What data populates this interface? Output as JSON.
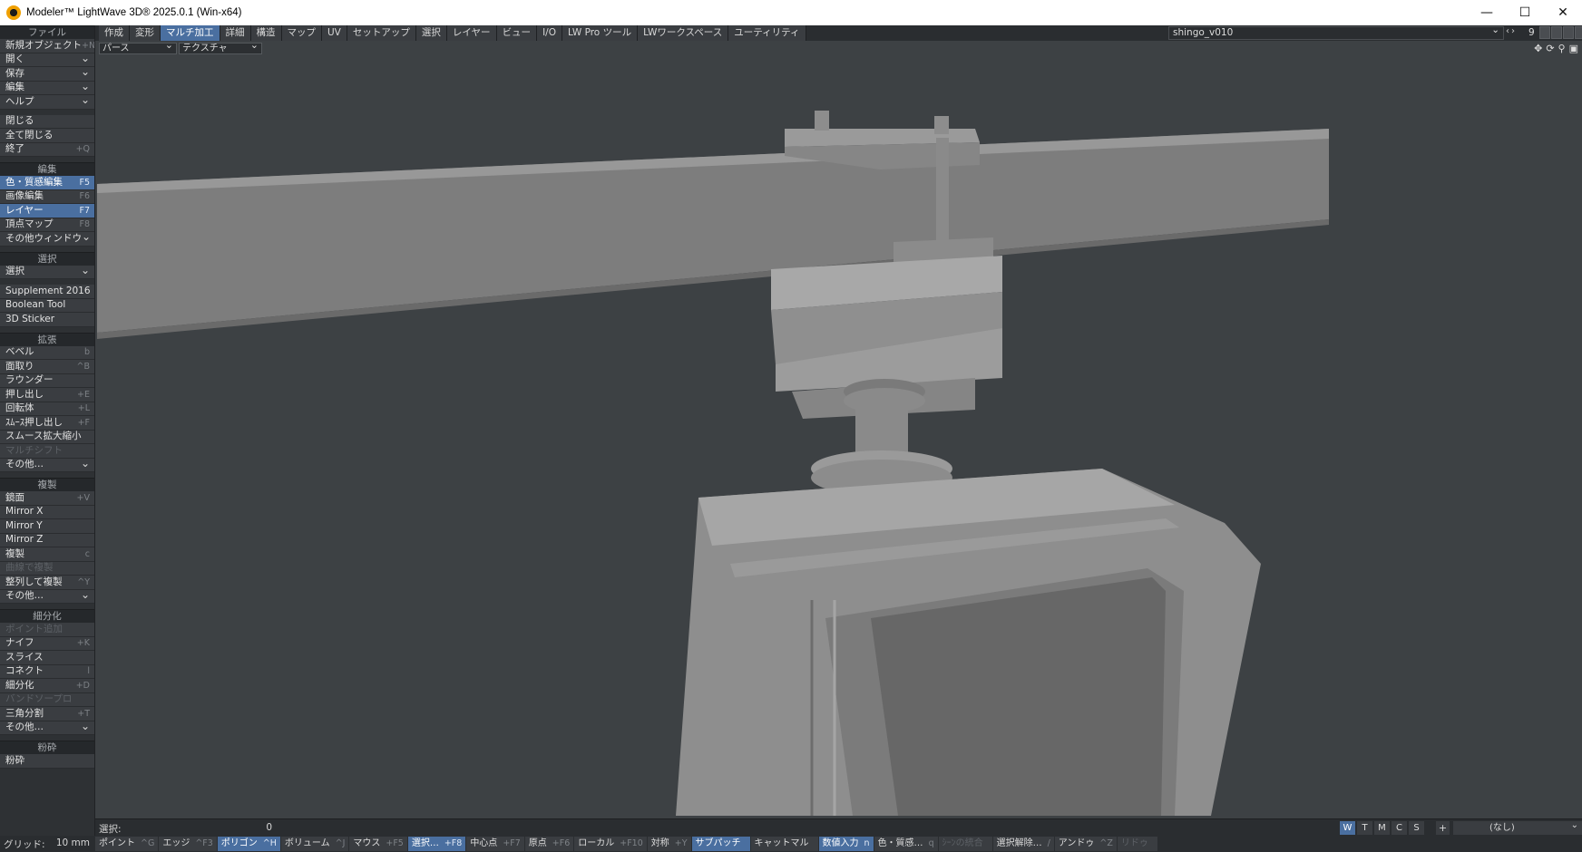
{
  "window": {
    "title": "Modeler™ LightWave 3D® 2025.0.1 (Win-x64)",
    "minimize": "—",
    "maximize": "☐",
    "close": "✕"
  },
  "tabs": [
    "作成",
    "変形",
    "マルチ加工",
    "詳細",
    "構造",
    "マップ",
    "UV",
    "セットアップ",
    "選択",
    "レイヤー",
    "ビュー",
    "I/O",
    "LW Pro ツール",
    "LWワークスペース",
    "ユーティリティ"
  ],
  "active_tab": "マルチ加工",
  "scene": {
    "name": "shingo_v010",
    "layer_number": "9"
  },
  "viewport": {
    "view_mode": "パース",
    "render_mode": "テクスチャ"
  },
  "sidebar": {
    "file_header": "ファイル",
    "file": [
      {
        "label": "新規オブジェクト",
        "sc": "+N"
      },
      {
        "label": "開く",
        "dd": true
      },
      {
        "label": "保存",
        "dd": true
      },
      {
        "label": "編集",
        "dd": true
      },
      {
        "label": "ヘルプ",
        "dd": true
      }
    ],
    "file2": [
      {
        "label": "閉じる",
        "sc": ""
      },
      {
        "label": "全て閉じる",
        "sc": ""
      },
      {
        "label": "終了",
        "sc": "+Q"
      }
    ],
    "edit_header": "編集",
    "edit": [
      {
        "label": "色・質感編集",
        "sc": "F5",
        "active": true
      },
      {
        "label": "画像編集",
        "sc": "F6"
      },
      {
        "label": "レイヤー",
        "sc": "F7",
        "active": true
      },
      {
        "label": "頂点マップ",
        "sc": "F8"
      },
      {
        "label": "その他ウィンドウ",
        "dd": true
      }
    ],
    "select_header": "選択",
    "select": [
      {
        "label": "選択",
        "dd": true
      }
    ],
    "plugins": [
      {
        "label": "Supplement 2016",
        "sc": ""
      },
      {
        "label": "Boolean Tool",
        "sc": ""
      },
      {
        "label": "3D Sticker",
        "sc": ""
      }
    ],
    "extend_header": "拡張",
    "extend": [
      {
        "label": "ベベル",
        "sc": "b"
      },
      {
        "label": "面取り",
        "sc": "^B"
      },
      {
        "label": "ラウンダー",
        "sc": ""
      },
      {
        "label": "押し出し",
        "sc": "+E"
      },
      {
        "label": "回転体",
        "sc": "+L"
      },
      {
        "label": "ｽﾑｰｽ押し出し",
        "sc": "+F"
      },
      {
        "label": "スムース拡大縮小",
        "sc": ""
      },
      {
        "label": "マルチシフト",
        "sc": "",
        "disabled": true
      },
      {
        "label": "その他…",
        "dd": true
      }
    ],
    "duplicate_header": "複製",
    "duplicate": [
      {
        "label": "鏡面",
        "sc": "+V"
      },
      {
        "label": "Mirror X",
        "sc": ""
      },
      {
        "label": "Mirror Y",
        "sc": ""
      },
      {
        "label": "Mirror Z",
        "sc": ""
      },
      {
        "label": "複製",
        "sc": "c"
      },
      {
        "label": "曲線で複製",
        "sc": "",
        "disabled": true
      },
      {
        "label": "整列して複製",
        "sc": "^Y"
      },
      {
        "label": "その他…",
        "dd": true
      }
    ],
    "subdivide_header": "細分化",
    "subdivide": [
      {
        "label": "ポイント追加",
        "sc": "",
        "disabled": true
      },
      {
        "label": "ナイフ",
        "sc": "+K"
      },
      {
        "label": "スライス",
        "sc": ""
      },
      {
        "label": "コネクト",
        "sc": "l"
      },
      {
        "label": "細分化",
        "sc": "+D"
      },
      {
        "label": "バンドソープロ",
        "sc": "",
        "disabled": true
      },
      {
        "label": "三角分割",
        "sc": "+T"
      },
      {
        "label": "その他…",
        "dd": true
      }
    ],
    "shatter_header": "粉砕",
    "shatter": [
      {
        "label": "粉砕",
        "sc": ""
      }
    ]
  },
  "status": {
    "selection_label": "選択:",
    "selection_count": "0",
    "wtmcs": [
      "W",
      "T",
      "M",
      "C",
      "S"
    ],
    "plus": "+",
    "none_select": "(なし)"
  },
  "bottom": {
    "grid_label": "グリッド:",
    "grid_value": "10 mm",
    "buttons": [
      {
        "label": "ポイント",
        "sc": "^G"
      },
      {
        "label": "エッジ",
        "sc": "^F3"
      },
      {
        "label": "ポリゴン",
        "sc": "^H",
        "on": true
      },
      {
        "label": "ボリューム",
        "sc": "^J"
      },
      {
        "label": "マウス",
        "sc": "+F5"
      },
      {
        "label": "選択…",
        "sc": "+F8",
        "on": true
      },
      {
        "label": "中心点",
        "sc": "+F7"
      },
      {
        "label": "原点",
        "sc": "+F6"
      },
      {
        "label": "ローカル",
        "sc": "+F10"
      },
      {
        "label": "対称",
        "sc": "+Y"
      },
      {
        "label": "サブパッチ",
        "sc": "",
        "on": true
      },
      {
        "label": "キャットマル",
        "sc": ""
      },
      {
        "label": "数値入力",
        "sc": "n",
        "on": true
      },
      {
        "label": "色・質感…",
        "sc": "q"
      },
      {
        "label": "ｼｰﾝの統合",
        "sc": "",
        "dim": true
      },
      {
        "label": "選択解除…",
        "sc": "/"
      },
      {
        "label": "アンドゥ",
        "sc": "^Z"
      },
      {
        "label": "リドゥ",
        "sc": "",
        "dim": true
      }
    ]
  }
}
